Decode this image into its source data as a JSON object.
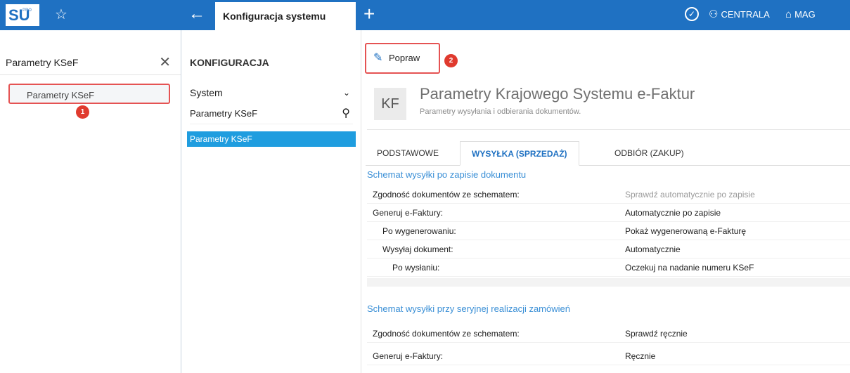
{
  "topbar": {
    "logo": "SU",
    "logo_small": "PRO",
    "active_tab": "Konfiguracja systemu",
    "right_items": [
      "CENTRALA",
      "MAG"
    ]
  },
  "left": {
    "search_value": "Parametry KSeF",
    "result": "Parametry KSeF",
    "badge": "1"
  },
  "mid": {
    "heading": "KONFIGURACJA",
    "selector": "System",
    "search_value": "Parametry KSeF",
    "active_item": "Parametry KSeF"
  },
  "main": {
    "popraw_label": "Popraw",
    "badge": "2",
    "kf": "KF",
    "title": "Parametry Krajowego Systemu e-Faktur",
    "subtitle": "Parametry wysyłania i odbierania dokumentów.",
    "tabs": [
      "PODSTAWOWE",
      "WYSYŁKA (SPRZEDAŻ)",
      "ODBIÓR (ZAKUP)"
    ],
    "section1": "Schemat wysyłki po zapisie dokumentu",
    "rows1": [
      {
        "label": "Zgodność dokumentów ze schematem:",
        "value": "Sprawdź automatycznie po zapisie"
      },
      {
        "label": "Generuj e-Faktury:",
        "value": "Automatycznie po zapisie"
      },
      {
        "label": "Po wygenerowaniu:",
        "value": "Pokaż wygenerowaną e-Fakturę"
      },
      {
        "label": "Wysyłaj dokument:",
        "value": "Automatycznie"
      },
      {
        "label": "Po wysłaniu:",
        "value": "Oczekuj na nadanie numeru KSeF"
      }
    ],
    "section2": "Schemat wysyłki przy seryjnej realizacji zamówień",
    "rows2": [
      {
        "label": "Zgodność dokumentów ze schematem:",
        "value": "Sprawdź ręcznie"
      },
      {
        "label": "Generuj e-Faktury:",
        "value": "Ręcznie"
      }
    ]
  }
}
